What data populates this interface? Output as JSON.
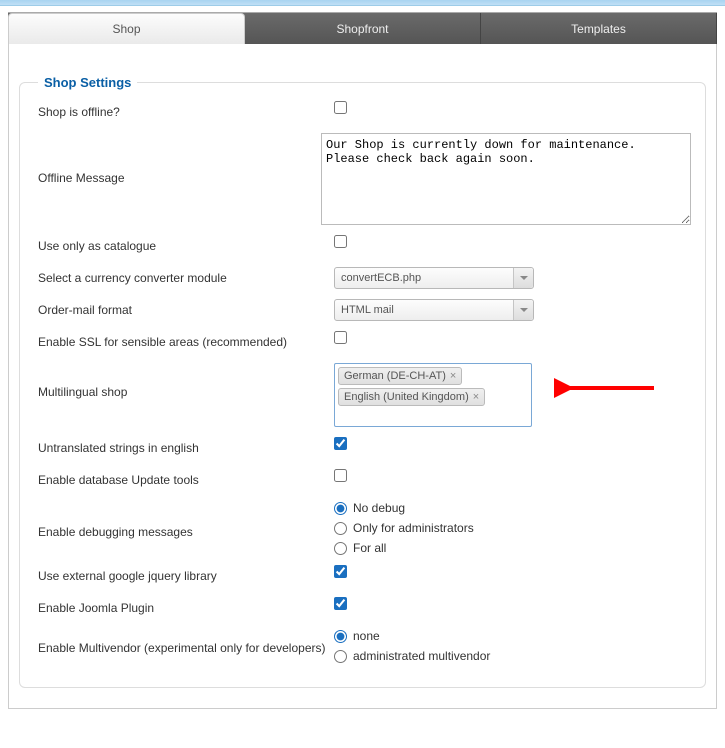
{
  "tabs": {
    "shop": "Shop",
    "shopfront": "Shopfront",
    "templates": "Templates"
  },
  "legend": "Shop Settings",
  "fields": {
    "offline": {
      "label": "Shop is offline?",
      "checked": false
    },
    "offlineMsg": {
      "label": "Offline Message",
      "value": "Our Shop is currently down for maintenance. Please check back again soon."
    },
    "catalogue": {
      "label": "Use only as catalogue",
      "checked": false
    },
    "currency": {
      "label": "Select a currency converter module",
      "value": "convertECB.php"
    },
    "ordermail": {
      "label": "Order-mail format",
      "value": "HTML mail"
    },
    "ssl": {
      "label": "Enable SSL for sensible areas (recommended)",
      "checked": false
    },
    "multilingual": {
      "label": "Multilingual shop",
      "tags": [
        "German (DE-CH-AT)",
        "English (United Kingdom)"
      ]
    },
    "untranslated": {
      "label": "Untranslated strings in english",
      "checked": true
    },
    "dbupdate": {
      "label": "Enable database Update tools",
      "checked": false
    },
    "debug": {
      "label": "Enable debugging messages",
      "options": [
        "No debug",
        "Only for administrators",
        "For all"
      ],
      "selected": 0
    },
    "jquery": {
      "label": "Use external google jquery library",
      "checked": true
    },
    "joomla": {
      "label": "Enable Joomla Plugin",
      "checked": true
    },
    "multivendor": {
      "label": "Enable Multivendor (experimental only for developers)",
      "options": [
        "none",
        "administrated multivendor"
      ],
      "selected": 0
    }
  }
}
